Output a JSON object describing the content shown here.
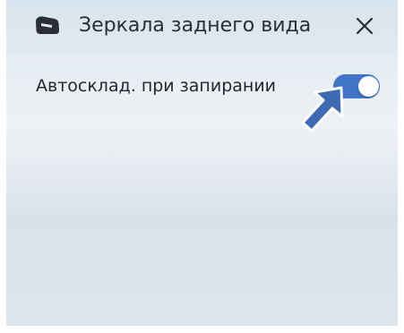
{
  "dialog": {
    "title": "Зеркала заднего вида",
    "icon": "rearview-mirror-icon",
    "close_icon": "close-icon"
  },
  "settings": [
    {
      "label": "Автосклад. при запирании",
      "state": "on",
      "accent_color": "#3f74c7"
    }
  ],
  "annotation": {
    "icon": "pointer-arrow-icon",
    "color": "#3d6ab3"
  }
}
